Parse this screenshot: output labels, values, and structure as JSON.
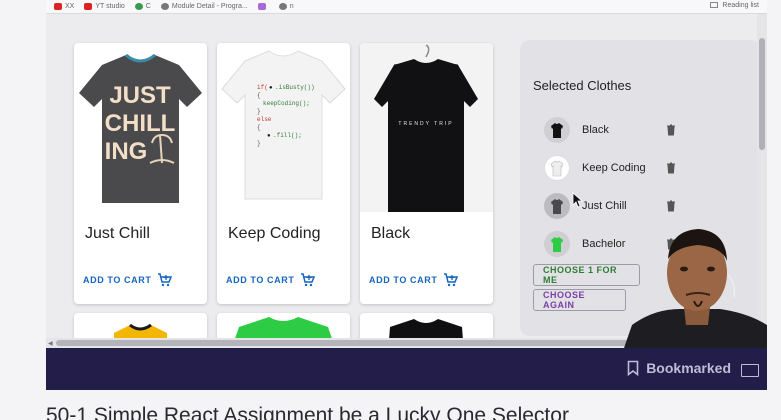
{
  "browser": {
    "bookmarks": [
      {
        "label": "XX",
        "icon": "youtube-icon"
      },
      {
        "label": "YT studio",
        "icon": "youtube-icon"
      },
      {
        "label": "C",
        "icon": "circle-icon"
      },
      {
        "label": "Module Detail - Progra...",
        "icon": "page-icon"
      },
      {
        "label": "",
        "icon": "figma-icon"
      },
      {
        "label": "n",
        "icon": "globe-icon"
      }
    ],
    "reading_list": "Reading list"
  },
  "products": [
    {
      "name": "Just Chill",
      "button": "ADD TO CART",
      "shirt_color": "#4a4a4d",
      "print": "JUST CHILL ING"
    },
    {
      "name": "Keep Coding",
      "button": "ADD TO CART",
      "shirt_color": "#f2f2f2",
      "print": "code"
    },
    {
      "name": "Black",
      "button": "ADD TO CART",
      "shirt_color": "#111114",
      "print": "TRENDY TRIP"
    }
  ],
  "selected": {
    "title": "Selected Clothes",
    "items": [
      {
        "name": "Black"
      },
      {
        "name": "Keep Coding"
      },
      {
        "name": "Just Chill"
      },
      {
        "name": "Bachelor"
      }
    ],
    "choose_button": "CHOOSE 1 FOR ME",
    "again_button": "CHOOSE AGAIN"
  },
  "player": {
    "bookmark_label": "Bookmarked"
  },
  "lesson": {
    "title": "50-1 Simple React Assignment be a Lucky One Selector"
  },
  "colors": {
    "accent_blue": "#1565c0",
    "green": "#2e7d32",
    "purple": "#7b3ea8",
    "player_bar": "#231d4a"
  }
}
